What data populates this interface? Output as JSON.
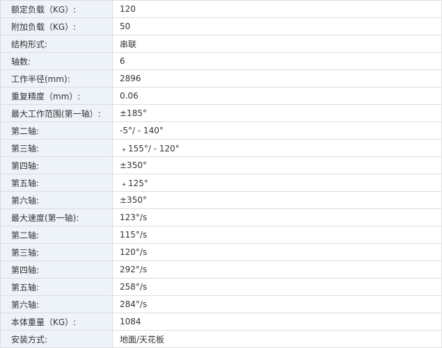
{
  "spec_table": {
    "rows": [
      {
        "label": "额定负载（KG）:",
        "value": "120"
      },
      {
        "label": "附加负载（KG）:",
        "value": "50"
      },
      {
        "label": "结构形式:",
        "value": "串联"
      },
      {
        "label": "轴数:",
        "value": "6"
      },
      {
        "label": "工作半径(mm):",
        "value": "2896"
      },
      {
        "label": "重复精度（mm）:",
        "value": "0.06"
      },
      {
        "label": "最大工作范围(第一轴）:",
        "value": "±185°"
      },
      {
        "label": "第二轴:",
        "value": "-5°/ - 140°"
      },
      {
        "label": "第三轴:",
        "value": "﹢155°/ - 120°"
      },
      {
        "label": "第四轴:",
        "value": "±350°"
      },
      {
        "label": "第五轴:",
        "value": "﹢125°"
      },
      {
        "label": "第六轴:",
        "value": "±350°"
      },
      {
        "label": "最大速度(第一轴):",
        "value": "123°/s"
      },
      {
        "label": "第二轴:",
        "value": "115°/s"
      },
      {
        "label": "第三轴:",
        "value": "120°/s"
      },
      {
        "label": "第四轴:",
        "value": "292°/s"
      },
      {
        "label": "第五轴:",
        "value": "258°/s"
      },
      {
        "label": "第六轴:",
        "value": "284°/s"
      },
      {
        "label": "本体重量（KG）:",
        "value": "1084"
      },
      {
        "label": "安装方式:",
        "value": "地面/天花板"
      }
    ]
  }
}
